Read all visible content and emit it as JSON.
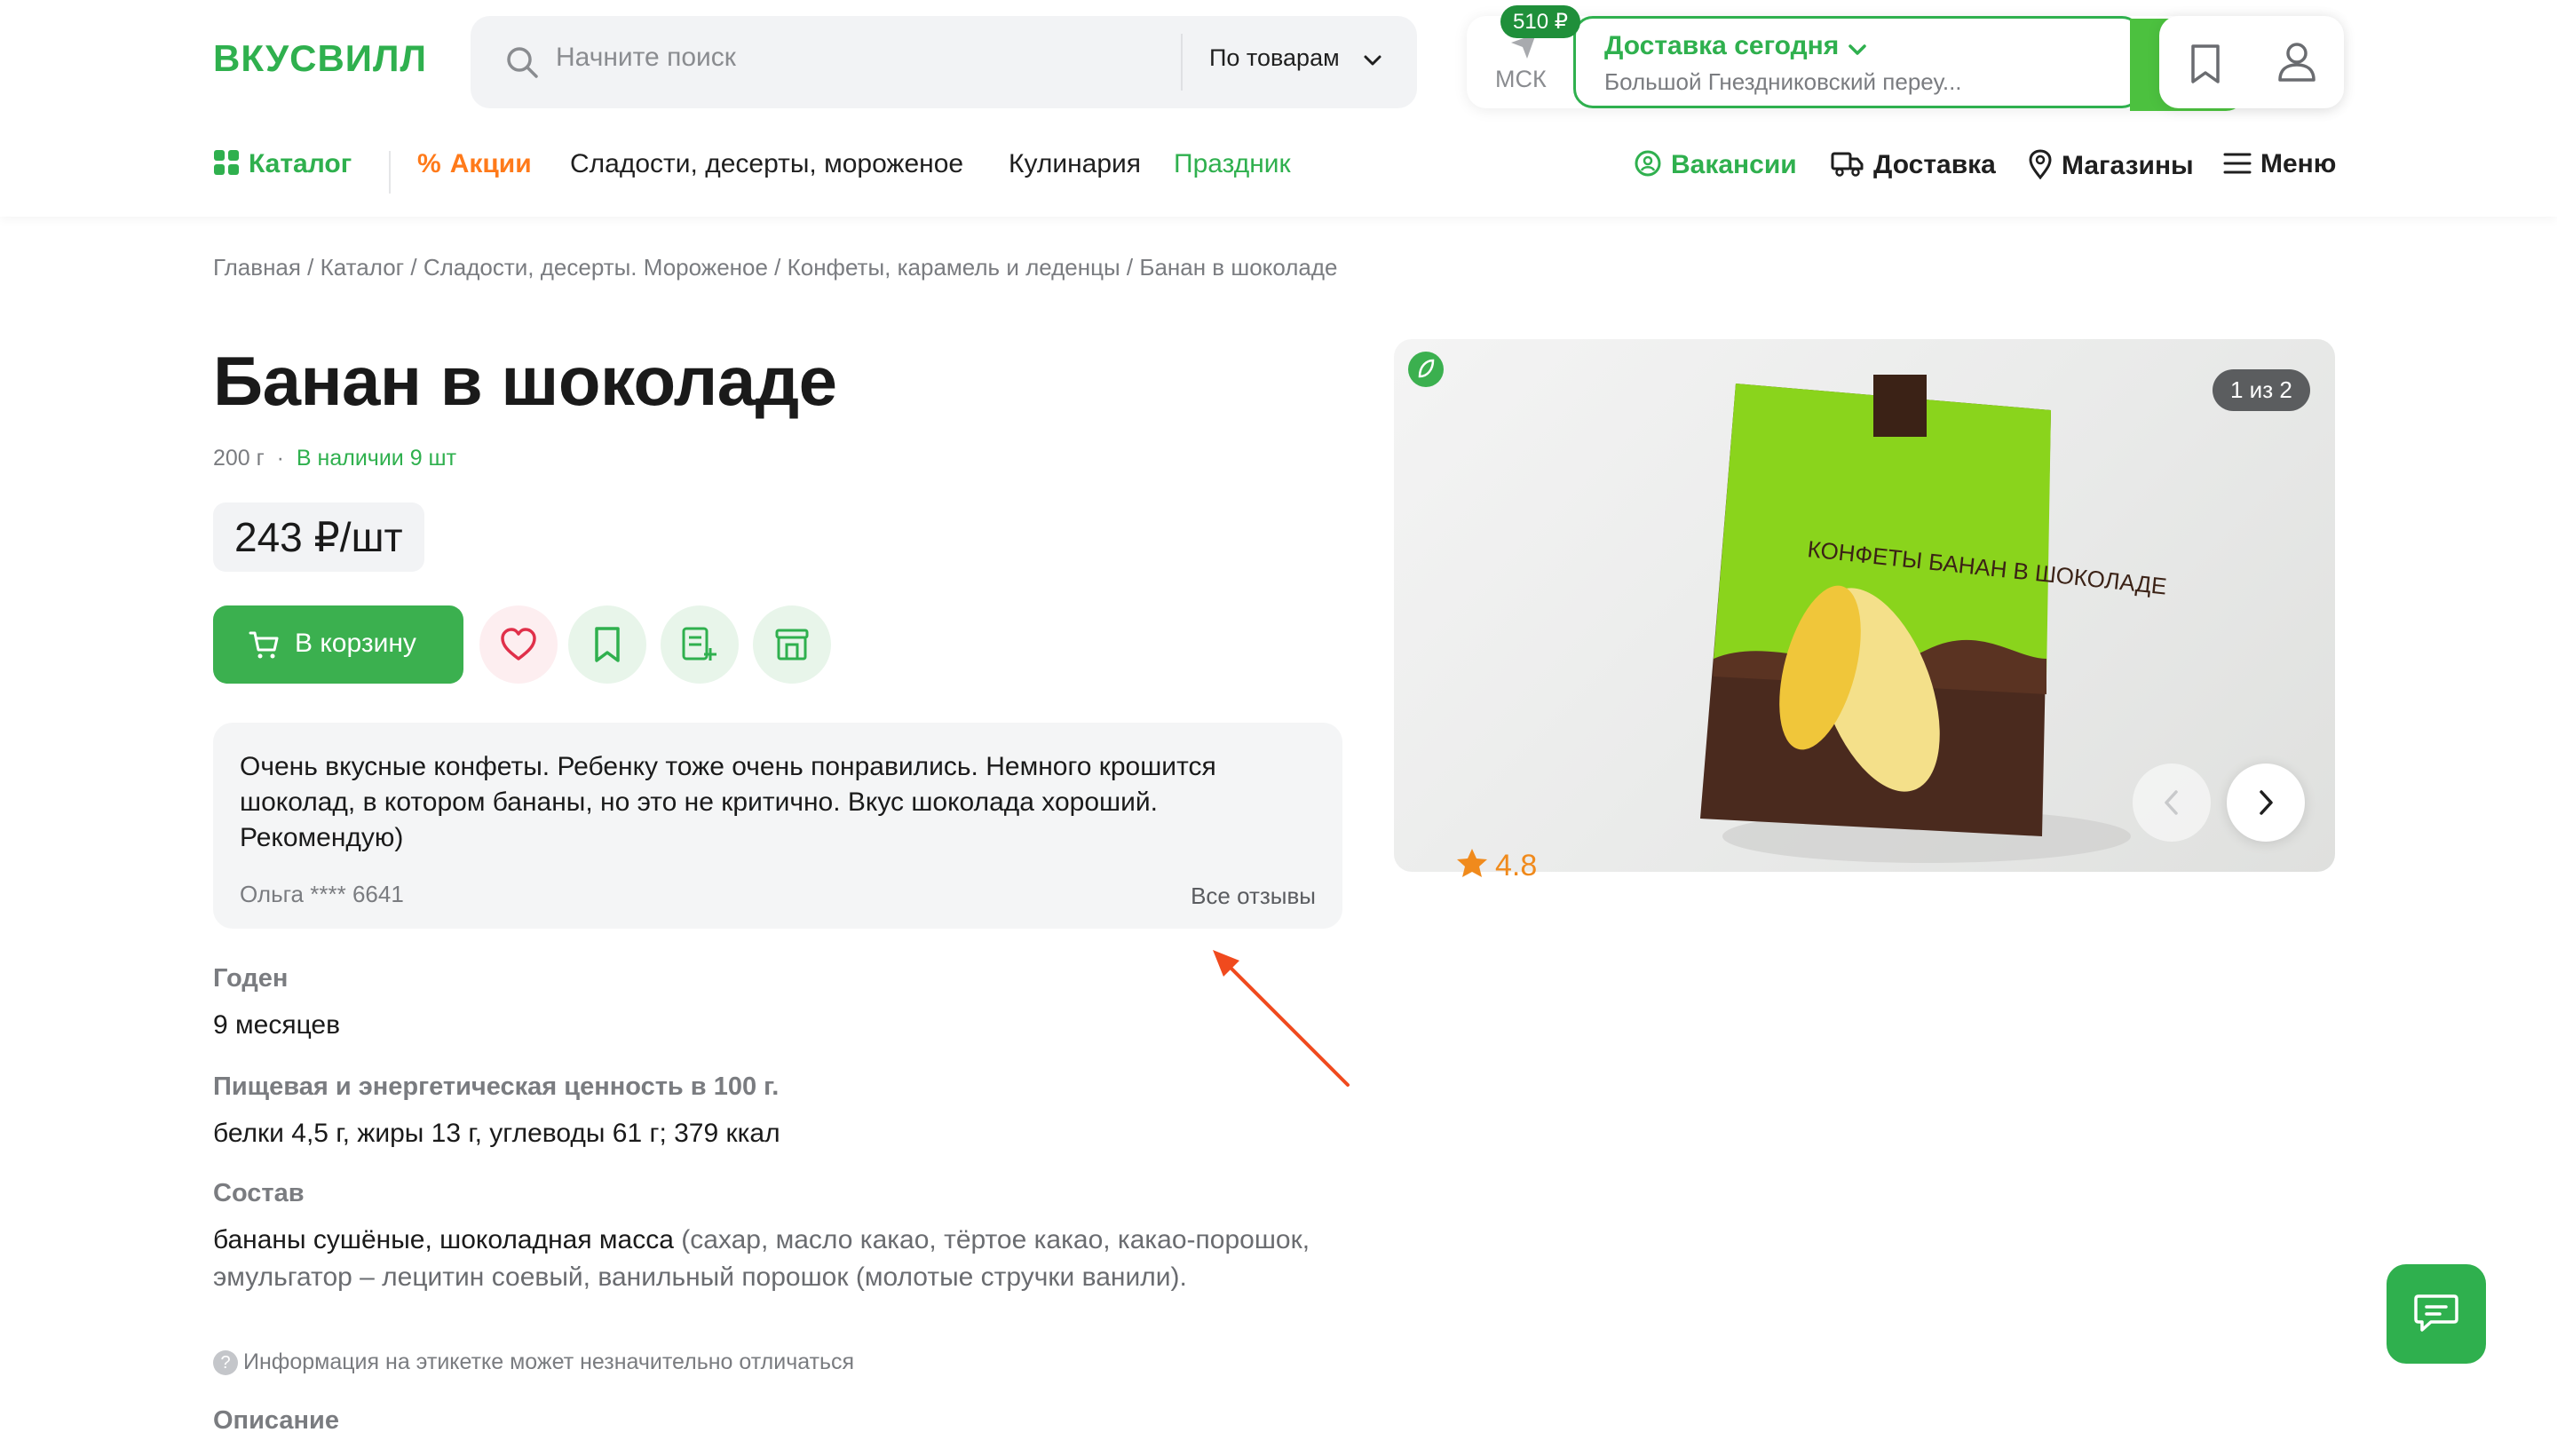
{
  "header": {
    "logo": "ВКУСВИЛЛ",
    "search": {
      "placeholder": "Начните поиск",
      "scope": "По товарам"
    },
    "city": "МСК",
    "delivery": {
      "title": "Доставка сегодня",
      "address": "Большой Гнездниковский переу..."
    },
    "cart_total": "510 ₽",
    "nav": {
      "catalog": "Каталог",
      "promo": "Акции",
      "sweets": "Сладости, десерты, мороженое",
      "cooking": "Кулинария",
      "holiday": "Праздник",
      "vacancies": "Вакансии",
      "shipping": "Доставка",
      "stores": "Магазины",
      "menu": "Меню"
    }
  },
  "breadcrumb": "Главная / Каталог / Сладости, десерты. Мороженое / Конфеты, карамель и леденцы / Банан в шоколаде",
  "product": {
    "title": "Банан в шоколаде",
    "weight": "200 г",
    "stock": "В наличии 9 шт",
    "price": "243 ₽/шт",
    "add_to_cart": "В корзину",
    "rating": "4.8",
    "image_counter": "1 из 2",
    "package_text": "КОНФЕТЫ БАНАН В ШОКОЛАДЕ"
  },
  "review": {
    "text": "Очень вкусные конфеты. Ребенку тоже очень понравились. Немного крошится шоколад, в котором бананы, но это не критично. Вкус шоколада хороший. Рекомендую)",
    "author": "Ольга **** 6641",
    "all_link": "Все отзывы"
  },
  "details": {
    "shelf_label": "Годен",
    "shelf_value": "9 месяцев",
    "nutrition_label": "Пищевая и энергетическая ценность в 100 г.",
    "nutrition_value": "белки 4,5 г, жиры 13 г, углеводы 61 г; 379 ккал",
    "composition_label": "Состав",
    "composition_main": "бананы сушёные, шоколадная масса",
    "composition_detail": " (сахар, масло какао, тёртое какао, какао-порошок, эмульгатор – лецитин соевый, ванильный порошок (молотые стручки ванили).",
    "disclaimer": "Информация на этикетке может незначительно отличаться",
    "description_label": "Описание"
  },
  "colors": {
    "brand_green": "#2fb04e",
    "cart_green": "#4cc13f",
    "promo_orange": "#ff7a1a",
    "rating_orange": "#f08a1c",
    "annotation_red": "#f04a1e"
  }
}
